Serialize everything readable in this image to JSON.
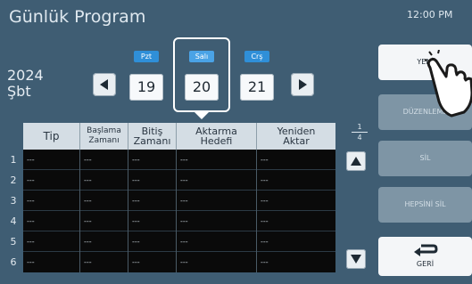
{
  "header": {
    "title": "Günlük Program",
    "clock": "12:00 PM"
  },
  "date": {
    "year": "2024",
    "weekday": "Şbt",
    "days": [
      {
        "tag": "Pzt",
        "num": "19"
      },
      {
        "tag": "Salı",
        "num": "20"
      },
      {
        "tag": "Crş",
        "num": "21"
      }
    ],
    "prev_icon": "triangle-left-icon",
    "next_icon": "triangle-right-icon"
  },
  "table": {
    "headers": [
      "Tip",
      "Başlama Zamanı",
      "Bitiş Zamanı",
      "Aktarma Hedefi",
      "Yeniden Aktar"
    ],
    "rows": [
      {
        "num": "1",
        "cells": [
          "---",
          "---",
          "---",
          "---",
          "---"
        ]
      },
      {
        "num": "2",
        "cells": [
          "---",
          "---",
          "---",
          "---",
          "---"
        ]
      },
      {
        "num": "3",
        "cells": [
          "---",
          "---",
          "---",
          "---",
          "---"
        ]
      },
      {
        "num": "4",
        "cells": [
          "---",
          "---",
          "---",
          "---",
          "---"
        ]
      },
      {
        "num": "5",
        "cells": [
          "---",
          "---",
          "---",
          "---",
          "---"
        ]
      },
      {
        "num": "6",
        "cells": [
          "---",
          "---",
          "---",
          "---",
          "---"
        ]
      }
    ]
  },
  "pager": {
    "current": "1",
    "total": "4"
  },
  "menu": {
    "new": "YENİ",
    "edit": "DÜZENLEME",
    "delete": "SİL",
    "delete_all": "HEPSİNİ SİL",
    "back": "GERİ",
    "back_icon": "return-arrow-icon"
  },
  "colors": {
    "background": "#3f5d73",
    "tag_blue": "#2f8fd8",
    "tag_selected": "#4aa3e6",
    "menu_active": "#f4f6f8",
    "menu_dim": "#7e95a5"
  }
}
